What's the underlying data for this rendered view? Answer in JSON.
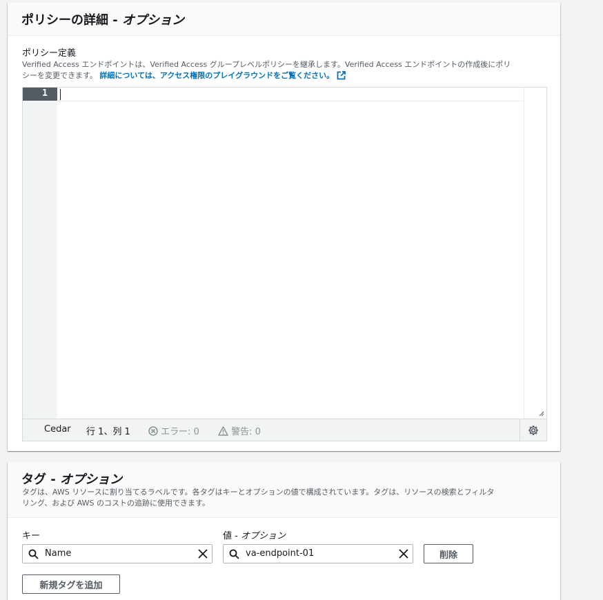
{
  "policy_panel": {
    "title": "ポリシーの詳細",
    "title_separator": " - ",
    "title_optional": "オプション",
    "field_label": "ポリシー定義",
    "description_line1": "Verified Access エンドポイントは、Verified Access グループレベルポリシーを継承します。Verified Access エンドポイントの作成後にポリ",
    "description_line2": "シーを変更できます。",
    "learn_more_link": "詳細については、アクセス権限のプレイグラウンドをご覧ください。",
    "editor": {
      "line_number": "1",
      "content": "",
      "language": "Cedar",
      "position": "行 1、列 1",
      "errors": "エラー: 0",
      "warnings": "警告: 0"
    }
  },
  "tags_panel": {
    "title": "タグ",
    "title_separator": " - ",
    "title_optional": "オプション",
    "description_line1": "タグは、AWS リソースに割り当てるラベルです。各タグはキーとオプションの値で構成されています。タグは、リソースの検索とフィルタ",
    "description_line2": "リング、および AWS のコストの追跡に使用できます。",
    "key_label": "キー",
    "value_label": "値",
    "value_label_optional": "オプション",
    "tags": [
      {
        "key": "Name",
        "value": "va-endpoint-01",
        "remove_label": "削除"
      }
    ],
    "add_tag_label": "新規タグを追加"
  },
  "colors": {
    "link": "#0073bb",
    "gutter_active": "#545b64",
    "page_background": "#f2f3f3"
  },
  "icons": [
    "external-link-icon",
    "error-icon",
    "warning-icon",
    "settings-gear-icon",
    "resize-handle-icon",
    "search-icon",
    "clear-icon"
  ]
}
